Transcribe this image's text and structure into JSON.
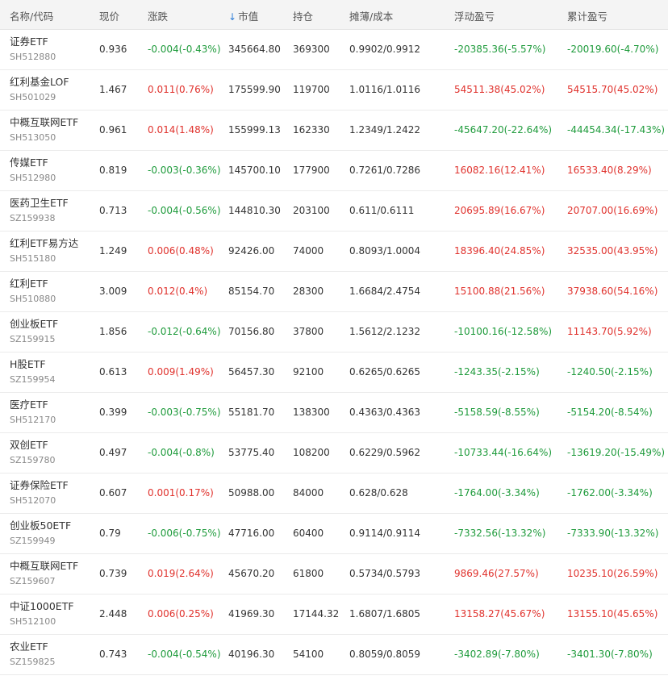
{
  "header": {
    "name_code": "名称/代码",
    "price": "现价",
    "change": "涨跌",
    "sort_indicator": "↓",
    "market_value": "市值",
    "holding": "持仓",
    "cost": "摊薄/成本",
    "floating_pl": "浮动盈亏",
    "accumulated_pl": "累计盈亏"
  },
  "colors": {
    "up": "#e0322d",
    "down": "#1f9b3c",
    "sort_arrow": "#2f7ed8"
  },
  "rows": [
    {
      "name": "证券ETF",
      "code": "SH512880",
      "price": "0.936",
      "change": "-0.004(-0.43%)",
      "change_dir": "down",
      "market_value": "345664.80",
      "holding": "369300",
      "cost": "0.9902/0.9912",
      "floating_pl": "-20385.36(-5.57%)",
      "floating_dir": "down",
      "accumulated_pl": "-20019.60(-4.70%)",
      "accumulated_dir": "down"
    },
    {
      "name": "红利基金LOF",
      "code": "SH501029",
      "price": "1.467",
      "change": "0.011(0.76%)",
      "change_dir": "up",
      "market_value": "175599.90",
      "holding": "119700",
      "cost": "1.0116/1.0116",
      "floating_pl": "54511.38(45.02%)",
      "floating_dir": "up",
      "accumulated_pl": "54515.70(45.02%)",
      "accumulated_dir": "up"
    },
    {
      "name": "中概互联网ETF",
      "code": "SH513050",
      "price": "0.961",
      "change": "0.014(1.48%)",
      "change_dir": "up",
      "market_value": "155999.13",
      "holding": "162330",
      "cost": "1.2349/1.2422",
      "floating_pl": "-45647.20(-22.64%)",
      "floating_dir": "down",
      "accumulated_pl": "-44454.34(-17.43%)",
      "accumulated_dir": "down"
    },
    {
      "name": "传媒ETF",
      "code": "SH512980",
      "price": "0.819",
      "change": "-0.003(-0.36%)",
      "change_dir": "down",
      "market_value": "145700.10",
      "holding": "177900",
      "cost": "0.7261/0.7286",
      "floating_pl": "16082.16(12.41%)",
      "floating_dir": "up",
      "accumulated_pl": "16533.40(8.29%)",
      "accumulated_dir": "up"
    },
    {
      "name": "医药卫生ETF",
      "code": "SZ159938",
      "price": "0.713",
      "change": "-0.004(-0.56%)",
      "change_dir": "down",
      "market_value": "144810.30",
      "holding": "203100",
      "cost": "0.611/0.6111",
      "floating_pl": "20695.89(16.67%)",
      "floating_dir": "up",
      "accumulated_pl": "20707.00(16.69%)",
      "accumulated_dir": "up"
    },
    {
      "name": "红利ETF易方达",
      "code": "SH515180",
      "price": "1.249",
      "change": "0.006(0.48%)",
      "change_dir": "up",
      "market_value": "92426.00",
      "holding": "74000",
      "cost": "0.8093/1.0004",
      "floating_pl": "18396.40(24.85%)",
      "floating_dir": "up",
      "accumulated_pl": "32535.00(43.95%)",
      "accumulated_dir": "up"
    },
    {
      "name": "红利ETF",
      "code": "SH510880",
      "price": "3.009",
      "change": "0.012(0.4%)",
      "change_dir": "up",
      "market_value": "85154.70",
      "holding": "28300",
      "cost": "1.6684/2.4754",
      "floating_pl": "15100.88(21.56%)",
      "floating_dir": "up",
      "accumulated_pl": "37938.60(54.16%)",
      "accumulated_dir": "up"
    },
    {
      "name": "创业板ETF",
      "code": "SZ159915",
      "price": "1.856",
      "change": "-0.012(-0.64%)",
      "change_dir": "down",
      "market_value": "70156.80",
      "holding": "37800",
      "cost": "1.5612/2.1232",
      "floating_pl": "-10100.16(-12.58%)",
      "floating_dir": "down",
      "accumulated_pl": "11143.70(5.92%)",
      "accumulated_dir": "up"
    },
    {
      "name": "H股ETF",
      "code": "SZ159954",
      "price": "0.613",
      "change": "0.009(1.49%)",
      "change_dir": "up",
      "market_value": "56457.30",
      "holding": "92100",
      "cost": "0.6265/0.6265",
      "floating_pl": "-1243.35(-2.15%)",
      "floating_dir": "down",
      "accumulated_pl": "-1240.50(-2.15%)",
      "accumulated_dir": "down"
    },
    {
      "name": "医疗ETF",
      "code": "SH512170",
      "price": "0.399",
      "change": "-0.003(-0.75%)",
      "change_dir": "down",
      "market_value": "55181.70",
      "holding": "138300",
      "cost": "0.4363/0.4363",
      "floating_pl": "-5158.59(-8.55%)",
      "floating_dir": "down",
      "accumulated_pl": "-5154.20(-8.54%)",
      "accumulated_dir": "down"
    },
    {
      "name": "双创ETF",
      "code": "SZ159780",
      "price": "0.497",
      "change": "-0.004(-0.8%)",
      "change_dir": "down",
      "market_value": "53775.40",
      "holding": "108200",
      "cost": "0.6229/0.5962",
      "floating_pl": "-10733.44(-16.64%)",
      "floating_dir": "down",
      "accumulated_pl": "-13619.20(-15.49%)",
      "accumulated_dir": "down"
    },
    {
      "name": "证券保险ETF",
      "code": "SH512070",
      "price": "0.607",
      "change": "0.001(0.17%)",
      "change_dir": "up",
      "market_value": "50988.00",
      "holding": "84000",
      "cost": "0.628/0.628",
      "floating_pl": "-1764.00(-3.34%)",
      "floating_dir": "down",
      "accumulated_pl": "-1762.00(-3.34%)",
      "accumulated_dir": "down"
    },
    {
      "name": "创业板50ETF",
      "code": "SZ159949",
      "price": "0.79",
      "change": "-0.006(-0.75%)",
      "change_dir": "down",
      "market_value": "47716.00",
      "holding": "60400",
      "cost": "0.9114/0.9114",
      "floating_pl": "-7332.56(-13.32%)",
      "floating_dir": "down",
      "accumulated_pl": "-7333.90(-13.32%)",
      "accumulated_dir": "down"
    },
    {
      "name": "中概互联网ETF",
      "code": "SZ159607",
      "price": "0.739",
      "change": "0.019(2.64%)",
      "change_dir": "up",
      "market_value": "45670.20",
      "holding": "61800",
      "cost": "0.5734/0.5793",
      "floating_pl": "9869.46(27.57%)",
      "floating_dir": "up",
      "accumulated_pl": "10235.10(26.59%)",
      "accumulated_dir": "up"
    },
    {
      "name": "中证1000ETF",
      "code": "SH512100",
      "price": "2.448",
      "change": "0.006(0.25%)",
      "change_dir": "up",
      "market_value": "41969.30",
      "holding": "17144.32",
      "cost": "1.6807/1.6805",
      "floating_pl": "13158.27(45.67%)",
      "floating_dir": "up",
      "accumulated_pl": "13155.10(45.65%)",
      "accumulated_dir": "up"
    },
    {
      "name": "农业ETF",
      "code": "SZ159825",
      "price": "0.743",
      "change": "-0.004(-0.54%)",
      "change_dir": "down",
      "market_value": "40196.30",
      "holding": "54100",
      "cost": "0.8059/0.8059",
      "floating_pl": "-3402.89(-7.80%)",
      "floating_dir": "down",
      "accumulated_pl": "-3401.30(-7.80%)",
      "accumulated_dir": "down"
    }
  ]
}
